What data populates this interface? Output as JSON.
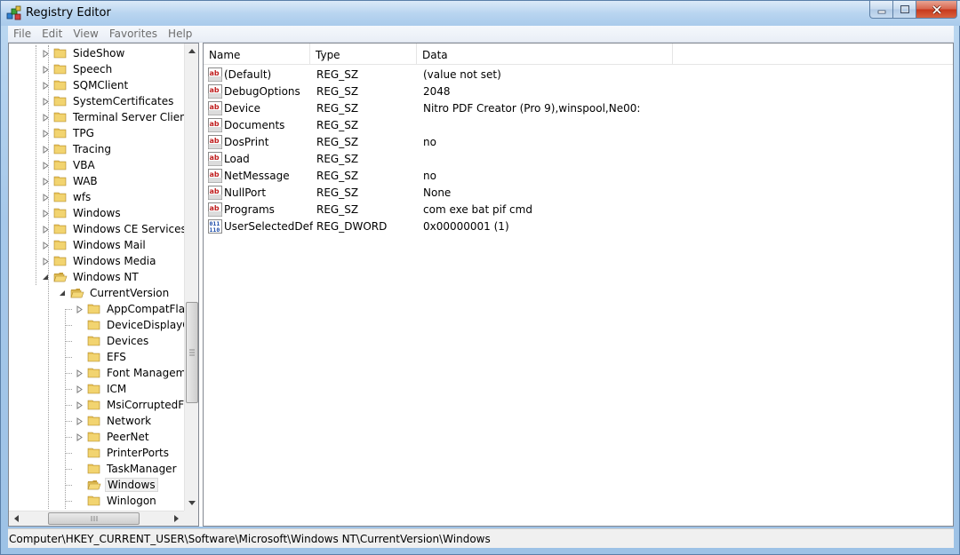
{
  "window": {
    "title": "Registry Editor",
    "icon": "registry-cubes-icon"
  },
  "menu": [
    "File",
    "Edit",
    "View",
    "Favorites",
    "Help"
  ],
  "tree": {
    "items": [
      {
        "label": "SideShow",
        "expander": "collapsed",
        "level": 0
      },
      {
        "label": "Speech",
        "expander": "collapsed",
        "level": 0
      },
      {
        "label": "SQMClient",
        "expander": "collapsed",
        "level": 0
      },
      {
        "label": "SystemCertificates",
        "expander": "collapsed",
        "level": 0
      },
      {
        "label": "Terminal Server Client",
        "expander": "collapsed",
        "level": 0
      },
      {
        "label": "TPG",
        "expander": "collapsed",
        "level": 0
      },
      {
        "label": "Tracing",
        "expander": "collapsed",
        "level": 0
      },
      {
        "label": "VBA",
        "expander": "collapsed",
        "level": 0
      },
      {
        "label": "WAB",
        "expander": "collapsed",
        "level": 0
      },
      {
        "label": "wfs",
        "expander": "collapsed",
        "level": 0
      },
      {
        "label": "Windows",
        "expander": "collapsed",
        "level": 0
      },
      {
        "label": "Windows CE Services",
        "expander": "collapsed",
        "level": 0
      },
      {
        "label": "Windows Mail",
        "expander": "collapsed",
        "level": 0
      },
      {
        "label": "Windows Media",
        "expander": "collapsed",
        "level": 0
      },
      {
        "label": "Windows NT",
        "expander": "expanded",
        "level": 0
      },
      {
        "label": "CurrentVersion",
        "expander": "expanded",
        "level": 1
      },
      {
        "label": "AppCompatFlag",
        "expander": "collapsed",
        "level": 2
      },
      {
        "label": "DeviceDisplayOb",
        "expander": "none",
        "level": 2
      },
      {
        "label": "Devices",
        "expander": "none",
        "level": 2
      },
      {
        "label": "EFS",
        "expander": "none",
        "level": 2
      },
      {
        "label": "Font Manageme",
        "expander": "collapsed",
        "level": 2
      },
      {
        "label": "ICM",
        "expander": "collapsed",
        "level": 2
      },
      {
        "label": "MsiCorruptedFile",
        "expander": "collapsed",
        "level": 2
      },
      {
        "label": "Network",
        "expander": "collapsed",
        "level": 2
      },
      {
        "label": "PeerNet",
        "expander": "collapsed",
        "level": 2
      },
      {
        "label": "PrinterPorts",
        "expander": "none",
        "level": 2
      },
      {
        "label": "TaskManager",
        "expander": "none",
        "level": 2
      },
      {
        "label": "Windows",
        "expander": "none",
        "level": 2,
        "selected": true
      },
      {
        "label": "Winlogon",
        "expander": "none",
        "level": 2
      }
    ]
  },
  "list": {
    "columns": [
      "Name",
      "Type",
      "Data"
    ],
    "rows": [
      {
        "icon": "string-value-icon",
        "name": "(Default)",
        "type": "REG_SZ",
        "data": "(value not set)"
      },
      {
        "icon": "string-value-icon",
        "name": "DebugOptions",
        "type": "REG_SZ",
        "data": "2048"
      },
      {
        "icon": "string-value-icon",
        "name": "Device",
        "type": "REG_SZ",
        "data": "Nitro PDF Creator (Pro 9),winspool,Ne00:"
      },
      {
        "icon": "string-value-icon",
        "name": "Documents",
        "type": "REG_SZ",
        "data": ""
      },
      {
        "icon": "string-value-icon",
        "name": "DosPrint",
        "type": "REG_SZ",
        "data": "no"
      },
      {
        "icon": "string-value-icon",
        "name": "Load",
        "type": "REG_SZ",
        "data": ""
      },
      {
        "icon": "string-value-icon",
        "name": "NetMessage",
        "type": "REG_SZ",
        "data": "no"
      },
      {
        "icon": "string-value-icon",
        "name": "NullPort",
        "type": "REG_SZ",
        "data": "None"
      },
      {
        "icon": "string-value-icon",
        "name": "Programs",
        "type": "REG_SZ",
        "data": "com exe bat pif cmd"
      },
      {
        "icon": "binary-value-icon",
        "name": "UserSelectedDef...",
        "type": "REG_DWORD",
        "data": "0x00000001 (1)"
      }
    ]
  },
  "status": {
    "path": "Computer\\HKEY_CURRENT_USER\\Software\\Microsoft\\Windows NT\\CurrentVersion\\Windows"
  },
  "colors": {
    "folder": "#e8c258",
    "selection": "#f0f0f0",
    "border": "#828790"
  }
}
